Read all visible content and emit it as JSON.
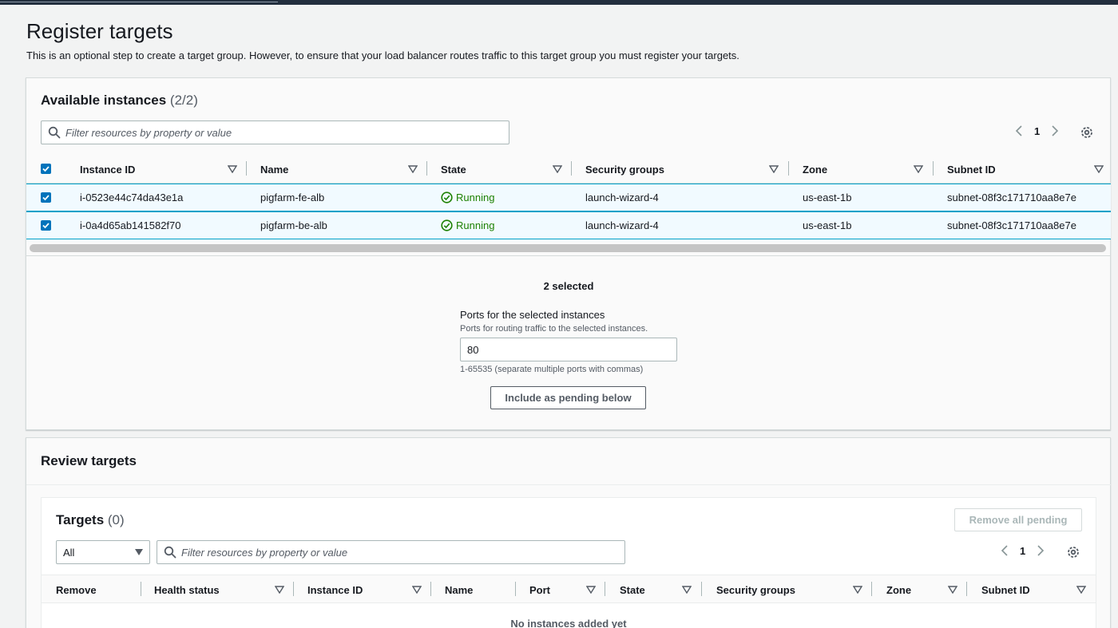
{
  "header": {
    "title": "Register targets",
    "description": "This is an optional step to create a target group. However, to ensure that your load balancer routes traffic to this target group you must register your targets."
  },
  "available": {
    "title": "Available instances",
    "count": "(2/2)",
    "filter_placeholder": "Filter resources by property or value",
    "page": "1",
    "columns": [
      "Instance ID",
      "Name",
      "State",
      "Security groups",
      "Zone",
      "Subnet ID"
    ],
    "rows": [
      {
        "instance_id": "i-0523e44c74da43e1a",
        "name": "pigfarm-fe-alb",
        "state": "Running",
        "security_groups": "launch-wizard-4",
        "zone": "us-east-1b",
        "subnet_id": "subnet-08f3c171710aa8e7e",
        "selected": true
      },
      {
        "instance_id": "i-0a4d65ab141582f70",
        "name": "pigfarm-be-alb",
        "state": "Running",
        "security_groups": "launch-wizard-4",
        "zone": "us-east-1b",
        "subnet_id": "subnet-08f3c171710aa8e7e",
        "selected": true
      }
    ],
    "selected_text": "2 selected",
    "ports_label": "Ports for the selected instances",
    "ports_description": "Ports for routing traffic to the selected instances.",
    "ports_value": "80",
    "ports_hint": "1-65535 (separate multiple ports with commas)",
    "include_button": "Include as pending below"
  },
  "review": {
    "title": "Review targets",
    "targets_title": "Targets",
    "targets_count": "(0)",
    "remove_all_button": "Remove all pending",
    "filter_select": "All",
    "filter_placeholder": "Filter resources by property or value",
    "page": "1",
    "columns": [
      "Remove",
      "Health status",
      "Instance ID",
      "Name",
      "Port",
      "State",
      "Security groups",
      "Zone",
      "Subnet ID"
    ],
    "empty_text": "No instances added yet"
  },
  "colors": {
    "accent": "#0073bb",
    "success": "#1d8102",
    "selected_row_bg": "#f1faff",
    "selected_row_border": "#00a1c9"
  }
}
